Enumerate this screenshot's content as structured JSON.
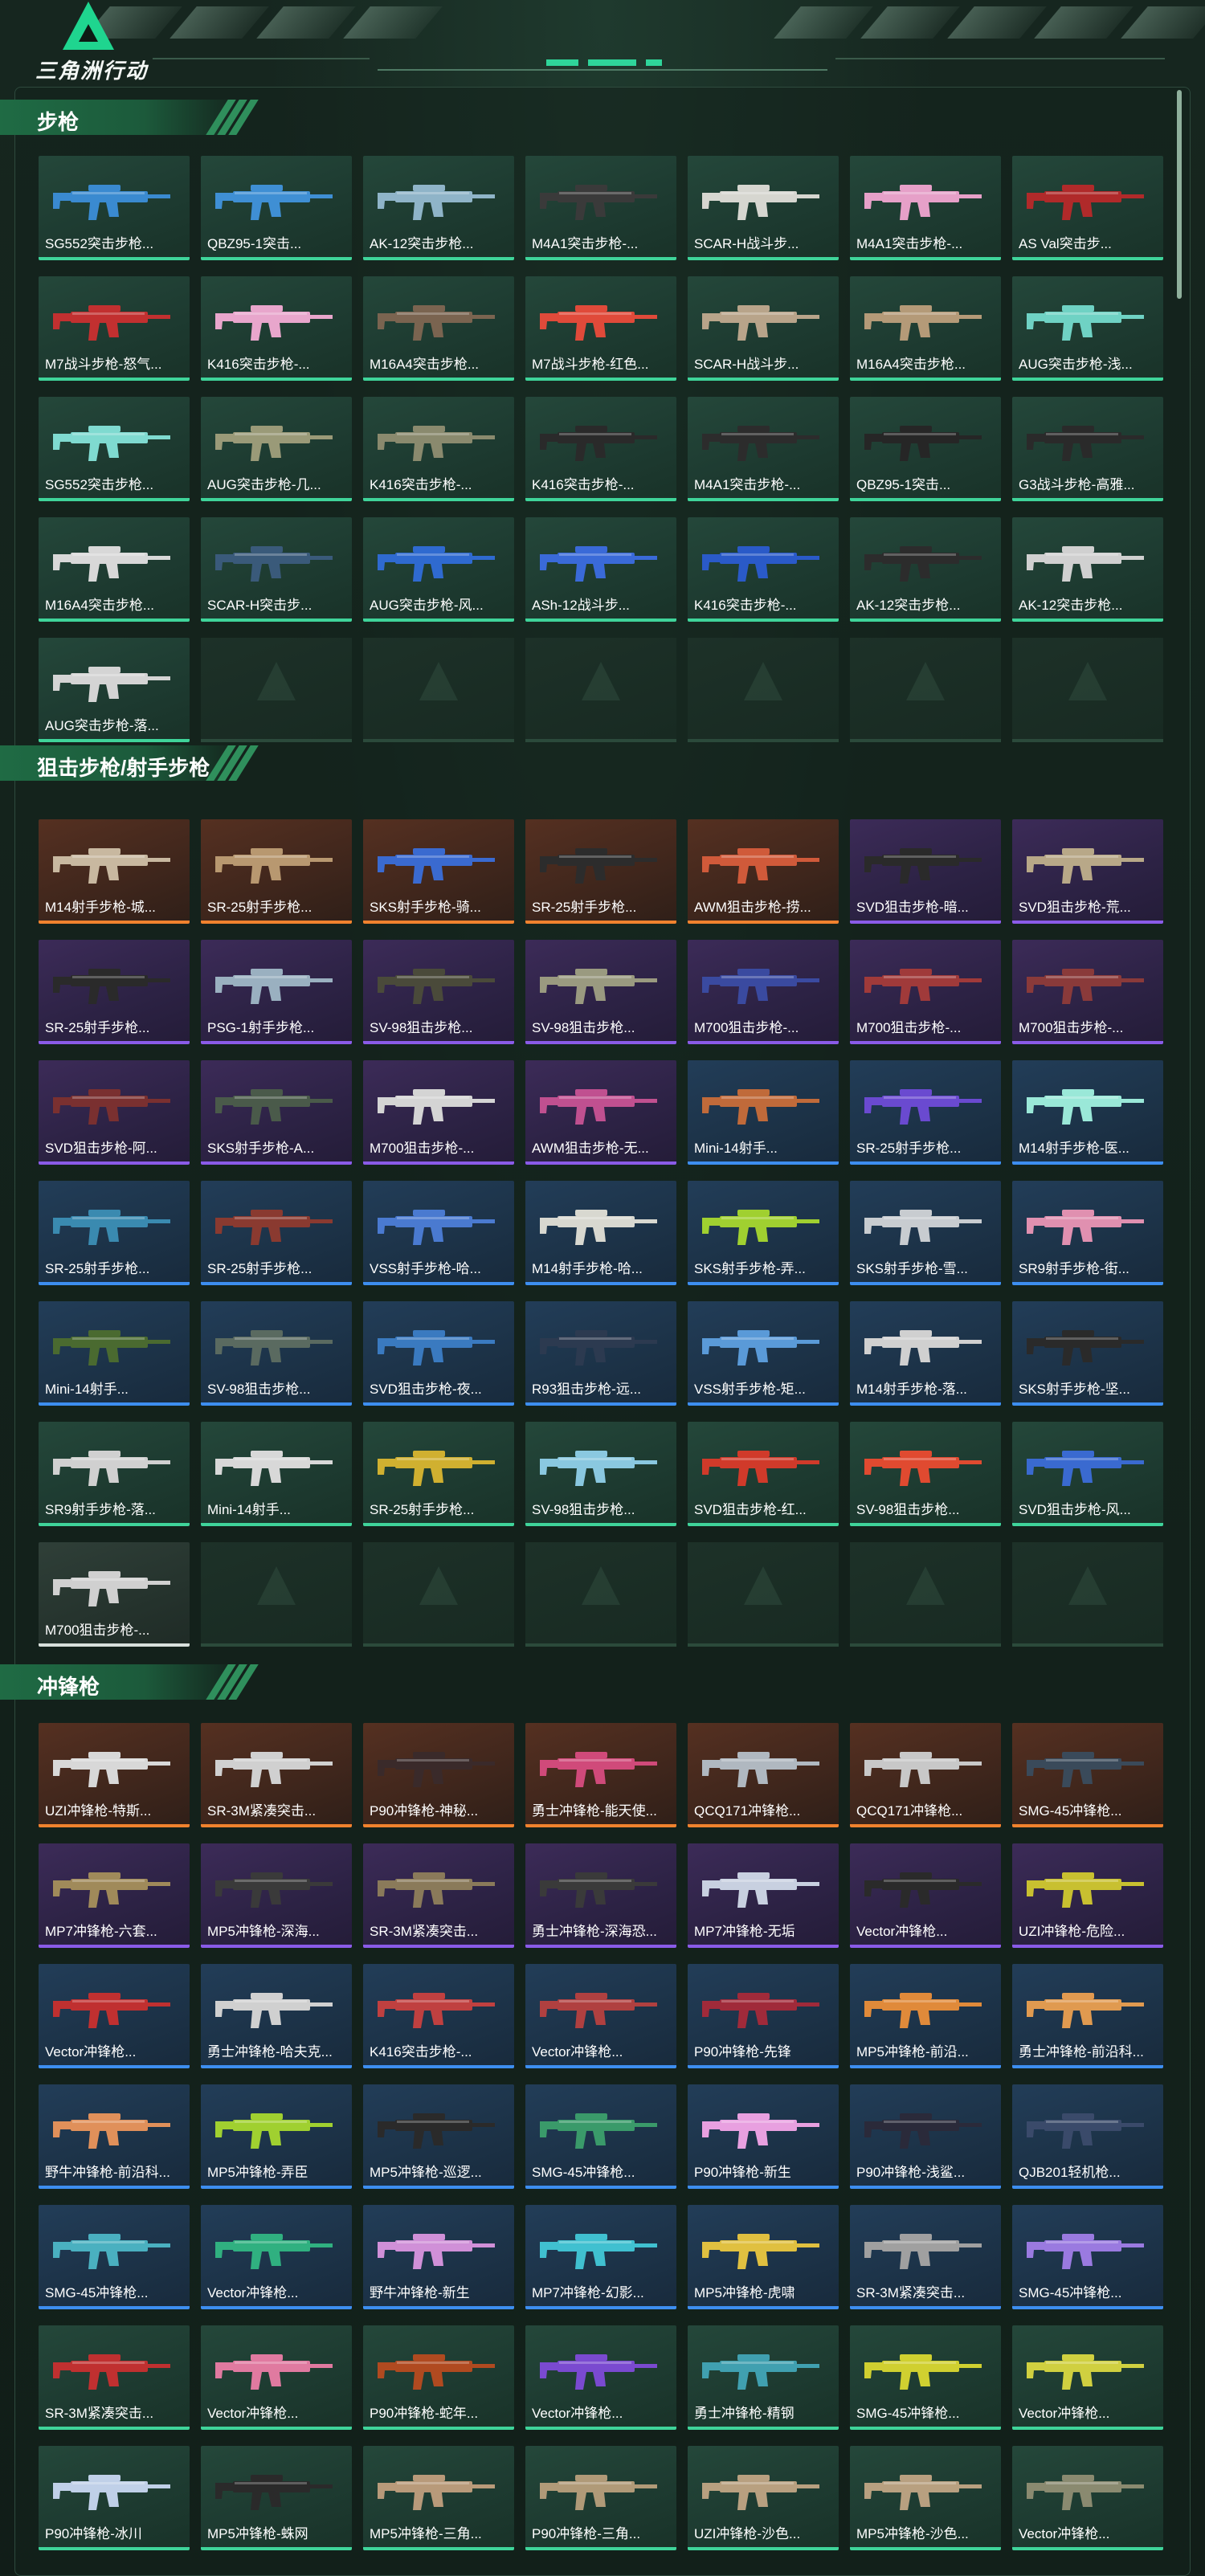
{
  "header": {
    "logo_text": "三角洲行动"
  },
  "colors": {
    "common": "#d8e0dc",
    "uncommon": "#3fd49a",
    "rare": "#3d8ef0",
    "epic": "#8a5be8",
    "legendary": "#f0822e"
  },
  "sections": [
    {
      "title": "步枪",
      "empty_slots": 6,
      "items": [
        {
          "name": "SG552突击步枪...",
          "rarity": "green",
          "gun": "#3a8ad0"
        },
        {
          "name": "QBZ95-1突击...",
          "rarity": "green",
          "gun": "#3f8fd4"
        },
        {
          "name": "AK-12突击步枪...",
          "rarity": "green",
          "gun": "#8fb4c8"
        },
        {
          "name": "M4A1突击步枪-...",
          "rarity": "green",
          "gun": "#3a3a3a"
        },
        {
          "name": "SCAR-H战斗步...",
          "rarity": "green",
          "gun": "#d6d6d0"
        },
        {
          "name": "M4A1突击步枪-...",
          "rarity": "green",
          "gun": "#e6a0c8"
        },
        {
          "name": "AS Val突击步...",
          "rarity": "green",
          "gun": "#b02a2a"
        },
        {
          "name": "M7战斗步枪-怒气...",
          "rarity": "green",
          "gun": "#c23030"
        },
        {
          "name": "K416突击步枪-...",
          "rarity": "green",
          "gun": "#e8a6cc"
        },
        {
          "name": "M16A4突击步枪...",
          "rarity": "green",
          "gun": "#7a6450"
        },
        {
          "name": "M7战斗步枪-红色...",
          "rarity": "green",
          "gun": "#e04a3a"
        },
        {
          "name": "SCAR-H战斗步...",
          "rarity": "green",
          "gun": "#b8a48a"
        },
        {
          "name": "M16A4突击步枪...",
          "rarity": "green",
          "gun": "#b49a78"
        },
        {
          "name": "AUG突击步枪-浅...",
          "rarity": "green",
          "gun": "#6fd2c4"
        },
        {
          "name": "SG552突击步枪...",
          "rarity": "green",
          "gun": "#7fdad0"
        },
        {
          "name": "AUG突击步枪-几...",
          "rarity": "green",
          "gun": "#9a9a78"
        },
        {
          "name": "K416突击步枪-...",
          "rarity": "green",
          "gun": "#8a8a6e"
        },
        {
          "name": "K416突击步枪-...",
          "rarity": "green",
          "gun": "#2a2a2a"
        },
        {
          "name": "M4A1突击步枪-...",
          "rarity": "green",
          "gun": "#2c2c2c"
        },
        {
          "name": "QBZ95-1突击...",
          "rarity": "green",
          "gun": "#262626"
        },
        {
          "name": "G3战斗步枪-高雅...",
          "rarity": "green",
          "gun": "#2a2a2a"
        },
        {
          "name": "M16A4突击步枪...",
          "rarity": "green",
          "gun": "#d8d8d8"
        },
        {
          "name": "SCAR-H突击步...",
          "rarity": "green",
          "gun": "#3a5a7a"
        },
        {
          "name": "AUG突击步枪-风...",
          "rarity": "green",
          "gun": "#2f6ad0"
        },
        {
          "name": "ASh-12战斗步...",
          "rarity": "green",
          "gun": "#3a6ad8"
        },
        {
          "name": "K416突击步枪-...",
          "rarity": "green",
          "gun": "#2a5ac8"
        },
        {
          "name": "AK-12突击步枪...",
          "rarity": "green",
          "gun": "#2c2c2c"
        },
        {
          "name": "AK-12突击步枪...",
          "rarity": "green",
          "gun": "#d0d0d0"
        },
        {
          "name": "AUG突击步枪-落...",
          "rarity": "green",
          "gun": "#d4d4d4"
        }
      ]
    },
    {
      "title": "狙击步枪/射手步枪",
      "empty_slots": 6,
      "items": [
        {
          "name": "M14射手步枪-城...",
          "rarity": "orange",
          "gun": "#c8b8a0"
        },
        {
          "name": "SR-25射手步枪...",
          "rarity": "orange",
          "gun": "#b89870"
        },
        {
          "name": "SKS射手步枪-骑...",
          "rarity": "orange",
          "gun": "#3a6ad0"
        },
        {
          "name": "SR-25射手步枪...",
          "rarity": "orange",
          "gun": "#2c2c2c"
        },
        {
          "name": "AWM狙击步枪-捞...",
          "rarity": "orange",
          "gun": "#d05a3a"
        },
        {
          "name": "SVD狙击步枪-暗...",
          "rarity": "purple",
          "gun": "#2a2a2a"
        },
        {
          "name": "SVD狙击步枪-荒...",
          "rarity": "purple",
          "gun": "#b8a888"
        },
        {
          "name": "SR-25射手步枪...",
          "rarity": "purple",
          "gun": "#2a2a2a"
        },
        {
          "name": "PSG-1射手步枪...",
          "rarity": "purple",
          "gun": "#9ab0c0"
        },
        {
          "name": "SV-98狙击步枪...",
          "rarity": "purple",
          "gun": "#4a4a3a"
        },
        {
          "name": "SV-98狙击步枪...",
          "rarity": "purple",
          "gun": "#9a9a80"
        },
        {
          "name": "M700狙击步枪-...",
          "rarity": "purple",
          "gun": "#3a4aa0"
        },
        {
          "name": "M700狙击步枪-...",
          "rarity": "purple",
          "gun": "#a03a3a"
        },
        {
          "name": "M700狙击步枪-...",
          "rarity": "purple",
          "gun": "#8a3a3a"
        },
        {
          "name": "SVD狙击步枪-阿...",
          "rarity": "purple",
          "gun": "#7a3030"
        },
        {
          "name": "SKS射手步枪-A...",
          "rarity": "purple",
          "gun": "#4a5a4a"
        },
        {
          "name": "M700狙击步枪-...",
          "rarity": "purple",
          "gun": "#d4d4d4"
        },
        {
          "name": "AWM狙击步枪-无...",
          "rarity": "purple",
          "gun": "#c05090"
        },
        {
          "name": "Mini-14射手...",
          "rarity": "blue",
          "gun": "#c06a3a"
        },
        {
          "name": "SR-25射手步枪...",
          "rarity": "blue",
          "gun": "#6a4ad0"
        },
        {
          "name": "M14射手步枪-医...",
          "rarity": "blue",
          "gun": "#9ae8d8"
        },
        {
          "name": "SR-25射手步枪...",
          "rarity": "blue",
          "gun": "#3a8ab0"
        },
        {
          "name": "SR-25射手步枪...",
          "rarity": "blue",
          "gun": "#8a3a30"
        },
        {
          "name": "VSS射手步枪-哈...",
          "rarity": "blue",
          "gun": "#4a7ad0"
        },
        {
          "name": "M14射手步枪-哈...",
          "rarity": "blue",
          "gun": "#d8d8d0"
        },
        {
          "name": "SKS射手步枪-弄...",
          "rarity": "blue",
          "gun": "#a0d030"
        },
        {
          "name": "SKS射手步枪-雪...",
          "rarity": "blue",
          "gun": "#c8ccd0"
        },
        {
          "name": "SR9射手步枪-街...",
          "rarity": "blue",
          "gun": "#e090b0"
        },
        {
          "name": "Mini-14射手...",
          "rarity": "blue",
          "gun": "#4a6a30"
        },
        {
          "name": "SV-98狙击步枪...",
          "rarity": "blue",
          "gun": "#5a6a60"
        },
        {
          "name": "SVD狙击步枪-夜...",
          "rarity": "blue",
          "gun": "#3a7ac0"
        },
        {
          "name": "R93狙击步枪-远...",
          "rarity": "blue",
          "gun": "#2c3a50"
        },
        {
          "name": "VSS射手步枪-矩...",
          "rarity": "blue",
          "gun": "#5a9ad8"
        },
        {
          "name": "M14射手步枪-落...",
          "rarity": "blue",
          "gun": "#d0d0d0"
        },
        {
          "name": "SKS射手步枪-坚...",
          "rarity": "blue",
          "gun": "#2a2a2a"
        },
        {
          "name": "SR9射手步枪-落...",
          "rarity": "green",
          "gun": "#d0d0d0"
        },
        {
          "name": "Mini-14射手...",
          "rarity": "green",
          "gun": "#d8d8d8"
        },
        {
          "name": "SR-25射手步枪...",
          "rarity": "green",
          "gun": "#d0b030"
        },
        {
          "name": "SV-98狙击步枪...",
          "rarity": "green",
          "gun": "#8ac8e0"
        },
        {
          "name": "SVD狙击步枪-红...",
          "rarity": "green",
          "gun": "#d03a2a"
        },
        {
          "name": "SV-98狙击步枪...",
          "rarity": "green",
          "gun": "#e04a30"
        },
        {
          "name": "SVD狙击步枪-风...",
          "rarity": "green",
          "gun": "#3a6ad0"
        },
        {
          "name": "M700狙击步枪-...",
          "rarity": "white",
          "gun": "#d0d0d0"
        }
      ]
    },
    {
      "title": "冲锋枪",
      "empty_slots": 0,
      "items": [
        {
          "name": "UZI冲锋枪-特斯...",
          "rarity": "orange",
          "gun": "#d8d8d8"
        },
        {
          "name": "SR-3M紧凑突击...",
          "rarity": "orange",
          "gun": "#d0d0d0"
        },
        {
          "name": "P90冲锋枪-神秘...",
          "rarity": "orange",
          "gun": "#3a2a2a"
        },
        {
          "name": "勇士冲锋枪-能天使...",
          "rarity": "orange",
          "gun": "#d04a7a"
        },
        {
          "name": "QCQ171冲锋枪...",
          "rarity": "orange",
          "gun": "#b0b8c0"
        },
        {
          "name": "QCQ171冲锋枪...",
          "rarity": "orange",
          "gun": "#c8c8c8"
        },
        {
          "name": "SMG-45冲锋枪...",
          "rarity": "orange",
          "gun": "#3a4a5a"
        },
        {
          "name": "MP7冲锋枪-六套...",
          "rarity": "purple",
          "gun": "#a08a5a"
        },
        {
          "name": "MP5冲锋枪-深海...",
          "rarity": "purple",
          "gun": "#3a3a3a"
        },
        {
          "name": "SR-3M紧凑突击...",
          "rarity": "purple",
          "gun": "#8a7a5a"
        },
        {
          "name": "勇士冲锋枪-深海恐...",
          "rarity": "purple",
          "gun": "#3a3a3a"
        },
        {
          "name": "MP7冲锋枪-无垢",
          "rarity": "purple",
          "gun": "#c8d0e0"
        },
        {
          "name": "Vector冲锋枪...",
          "rarity": "purple",
          "gun": "#2a2a2a"
        },
        {
          "name": "UZI冲锋枪-危险...",
          "rarity": "purple",
          "gun": "#c8c030"
        },
        {
          "name": "Vector冲锋枪...",
          "rarity": "blue",
          "gun": "#c03030"
        },
        {
          "name": "勇士冲锋枪-哈夫克...",
          "rarity": "blue",
          "gun": "#d0d0d0"
        },
        {
          "name": "K416突击步枪-...",
          "rarity": "blue",
          "gun": "#c04040"
        },
        {
          "name": "Vector冲锋枪...",
          "rarity": "blue",
          "gun": "#b04040"
        },
        {
          "name": "P90冲锋枪-先锋",
          "rarity": "blue",
          "gun": "#a02a3a"
        },
        {
          "name": "MP5冲锋枪-前沿...",
          "rarity": "blue",
          "gun": "#e08a3a"
        },
        {
          "name": "勇士冲锋枪-前沿科...",
          "rarity": "blue",
          "gun": "#e09a50"
        },
        {
          "name": "野牛冲锋枪-前沿科...",
          "rarity": "blue",
          "gun": "#e0905a"
        },
        {
          "name": "MP5冲锋枪-弄臣",
          "rarity": "blue",
          "gun": "#a0d030"
        },
        {
          "name": "MP5冲锋枪-巡逻...",
          "rarity": "blue",
          "gun": "#2a2a2a"
        },
        {
          "name": "SMG-45冲锋枪...",
          "rarity": "blue",
          "gun": "#3a9a6a"
        },
        {
          "name": "P90冲锋枪-新生",
          "rarity": "blue",
          "gun": "#e8a0e0"
        },
        {
          "name": "P90冲锋枪-浅鲨...",
          "rarity": "blue",
          "gun": "#2a2a3a"
        },
        {
          "name": "QJB201轻机枪...",
          "rarity": "blue",
          "gun": "#3a4a6a"
        },
        {
          "name": "SMG-45冲锋枪...",
          "rarity": "blue",
          "gun": "#4ab0c0"
        },
        {
          "name": "Vector冲锋枪...",
          "rarity": "blue",
          "gun": "#30b080"
        },
        {
          "name": "野牛冲锋枪-新生",
          "rarity": "blue",
          "gun": "#d090d8"
        },
        {
          "name": "MP7冲锋枪-幻影...",
          "rarity": "blue",
          "gun": "#40c0d0"
        },
        {
          "name": "MP5冲锋枪-虎啸",
          "rarity": "blue",
          "gun": "#e0c040"
        },
        {
          "name": "SR-3M紧凑突击...",
          "rarity": "blue",
          "gun": "#a0a0a0"
        },
        {
          "name": "SMG-45冲锋枪...",
          "rarity": "blue",
          "gun": "#9a7ae0"
        },
        {
          "name": "SR-3M紧凑突击...",
          "rarity": "green",
          "gun": "#c03030"
        },
        {
          "name": "Vector冲锋枪...",
          "rarity": "green",
          "gun": "#e07aa0"
        },
        {
          "name": "P90冲锋枪-蛇年...",
          "rarity": "green",
          "gun": "#b04a20"
        },
        {
          "name": "Vector冲锋枪...",
          "rarity": "green",
          "gun": "#7a4ad0"
        },
        {
          "name": "勇士冲锋枪-精钢",
          "rarity": "green",
          "gun": "#40a0b0"
        },
        {
          "name": "SMG-45冲锋枪...",
          "rarity": "green",
          "gun": "#d0d030"
        },
        {
          "name": "Vector冲锋枪...",
          "rarity": "green",
          "gun": "#d0d040"
        },
        {
          "name": "P90冲锋枪-冰川",
          "rarity": "green",
          "gun": "#c0d0e8"
        },
        {
          "name": "MP5冲锋枪-蛛网",
          "rarity": "green",
          "gun": "#2a2a2a"
        },
        {
          "name": "MP5冲锋枪-三角...",
          "rarity": "green",
          "gun": "#b89a7a"
        },
        {
          "name": "P90冲锋枪-三角...",
          "rarity": "green",
          "gun": "#b09a78"
        },
        {
          "name": "UZI冲锋枪-沙色...",
          "rarity": "green",
          "gun": "#b8a080"
        },
        {
          "name": "MP5冲锋枪-沙色...",
          "rarity": "green",
          "gun": "#b8a080"
        },
        {
          "name": "Vector冲锋枪...",
          "rarity": "green",
          "gun": "#8a8a70"
        }
      ]
    }
  ]
}
